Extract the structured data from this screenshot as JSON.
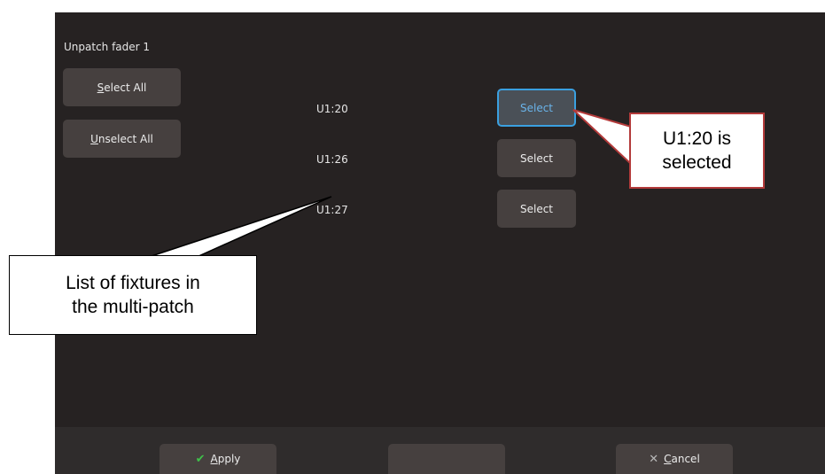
{
  "dialog": {
    "title": "Unpatch fader 1",
    "select_all": {
      "accel": "S",
      "rest": "elect All"
    },
    "unselect_all": {
      "accel": "U",
      "rest": "nselect All"
    }
  },
  "fixtures": [
    {
      "id": "U1:20",
      "button_label": "Select",
      "selected": true
    },
    {
      "id": "U1:26",
      "button_label": "Select",
      "selected": false
    },
    {
      "id": "U1:27",
      "button_label": "Select",
      "selected": false
    }
  ],
  "footer": {
    "apply": {
      "icon": "check-icon",
      "accel": "A",
      "rest": "pply"
    },
    "middle_label": "",
    "cancel": {
      "icon": "close-icon",
      "accel": "C",
      "rest": "ancel"
    }
  },
  "annotations": {
    "selected_callout": {
      "line1": "U1:20 is",
      "line2": "selected"
    },
    "fixtures_callout": {
      "line1": "List of fixtures in",
      "line2": "the multi-patch"
    }
  },
  "colors": {
    "panel_bg": "#262222",
    "button_bg": "#46403f",
    "selected_border": "#3aa0e0",
    "selected_text": "#6ab4ea",
    "apply_check": "#3fc24a",
    "callout_red_border": "#b33a3a"
  }
}
